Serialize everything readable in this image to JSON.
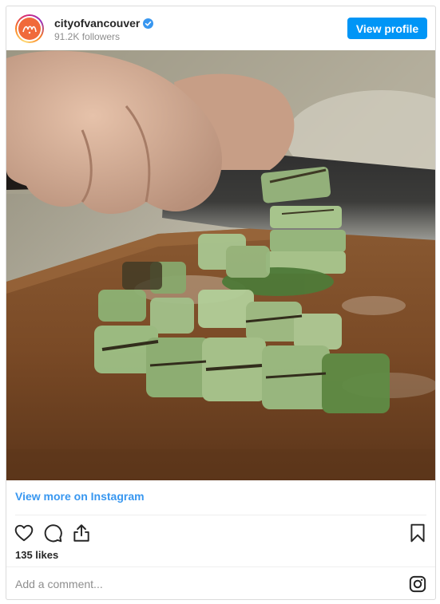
{
  "header": {
    "username": "cityofvancouver",
    "verified_icon": "verified-badge-icon",
    "followers": "91.2K followers",
    "view_profile_label": "View profile"
  },
  "photo": {
    "icon": "post-photo"
  },
  "view_more_label": "View more on Instagram",
  "actions": {
    "like_icon": "heart-icon",
    "comment_icon": "comment-icon",
    "share_icon": "share-icon",
    "save_icon": "bookmark-icon"
  },
  "likes": "135 likes",
  "comment": {
    "placeholder": "Add a comment...",
    "logo_icon": "instagram-icon"
  },
  "colors": {
    "accent": "#0095f6",
    "link": "#3897f0",
    "avatar": "#f06a3b"
  }
}
